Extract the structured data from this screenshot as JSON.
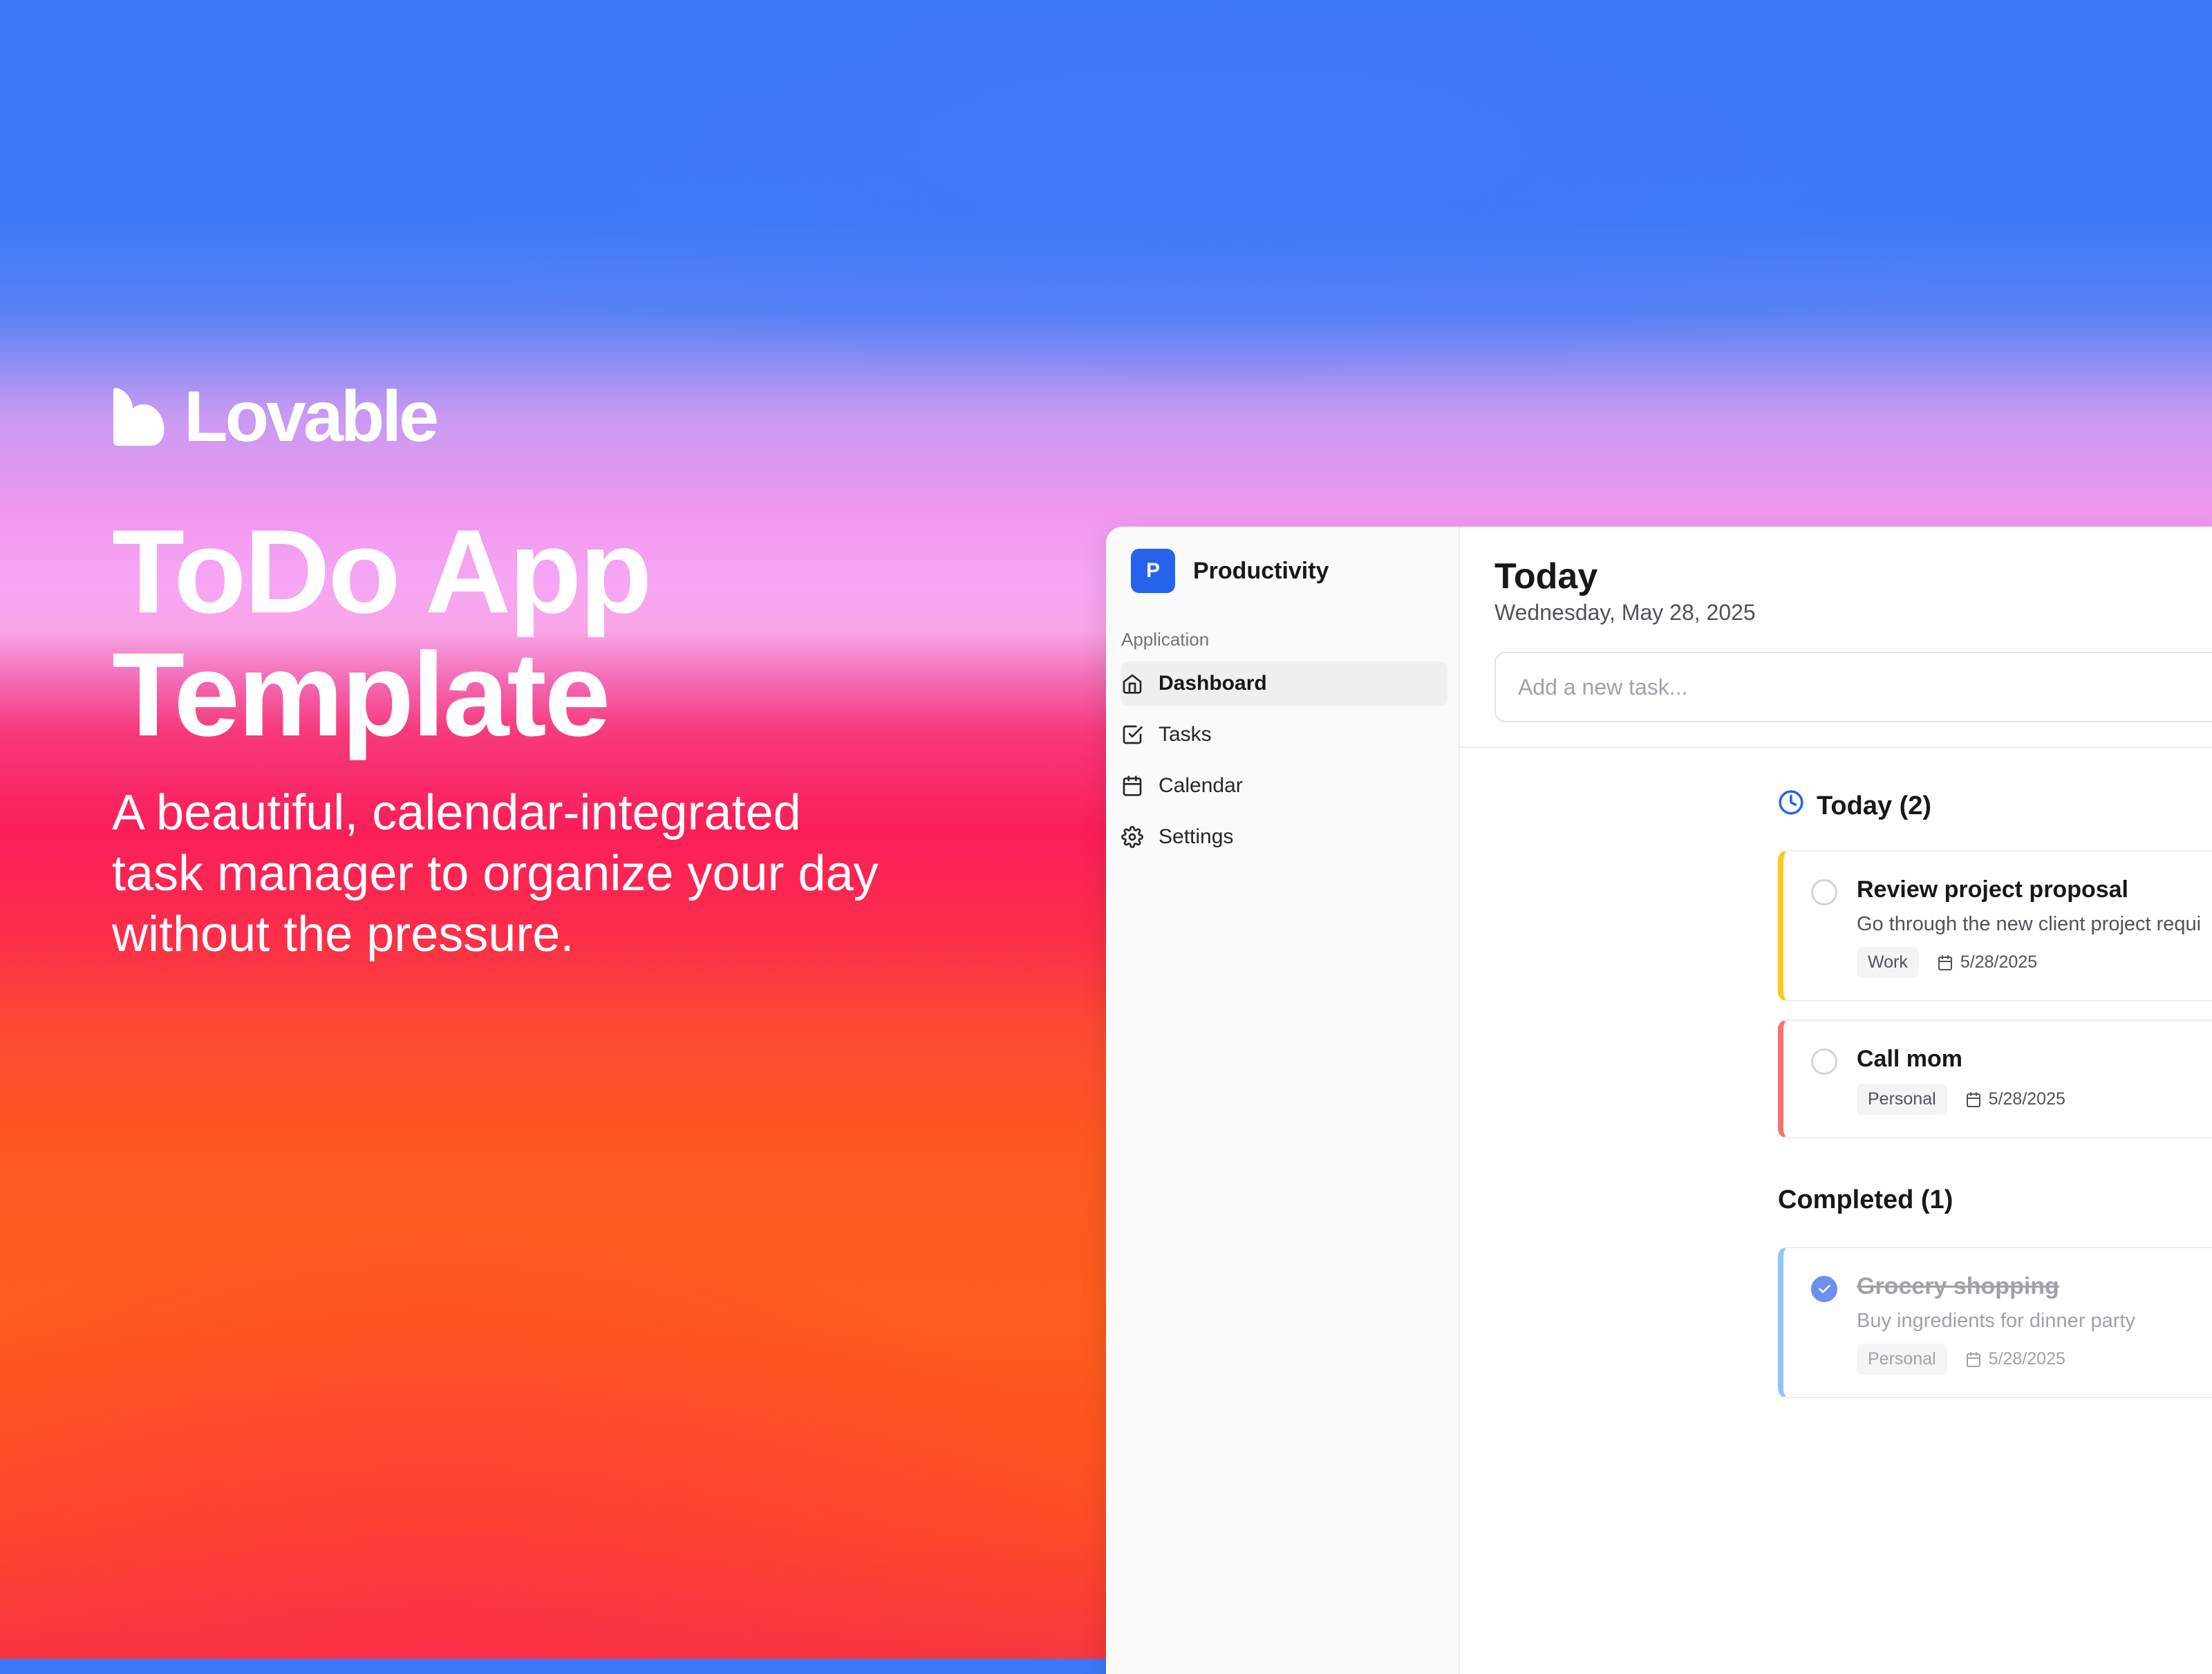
{
  "brand": {
    "name": "Lovable",
    "logo_icon": "lovable-heart-logo"
  },
  "hero": {
    "title_line1": "ToDo App",
    "title_line2": "Template",
    "subtitle": "A beautiful, calendar-integrated task manager to organize your day without the pressure."
  },
  "colors": {
    "accent": "#2563eb",
    "work": "#facc15",
    "personal": "#f87171",
    "done": "#93c5fd"
  },
  "sidebar": {
    "workspace_initial": "P",
    "workspace_name": "Productivity",
    "group_label": "Application",
    "items": [
      {
        "label": "Dashboard",
        "icon": "home-icon",
        "active": true
      },
      {
        "label": "Tasks",
        "icon": "checkbox-icon",
        "active": false
      },
      {
        "label": "Calendar",
        "icon": "calendar-icon",
        "active": false
      },
      {
        "label": "Settings",
        "icon": "gear-icon",
        "active": false
      }
    ]
  },
  "main": {
    "title": "Today",
    "date": "Wednesday, May 28, 2025",
    "add_placeholder": "Add a new task...",
    "today_section": "Today (2)",
    "completed_section": "Completed (1)",
    "tasks_today": [
      {
        "title": "Review project proposal",
        "desc": "Go through the new client project requi",
        "tag": "Work",
        "due": "5/28/2025"
      },
      {
        "title": "Call mom",
        "tag": "Personal",
        "due": "5/28/2025"
      }
    ],
    "tasks_completed": [
      {
        "title": "Grocery shopping",
        "desc": "Buy ingredients for dinner party",
        "tag": "Personal",
        "due": "5/28/2025"
      }
    ]
  }
}
